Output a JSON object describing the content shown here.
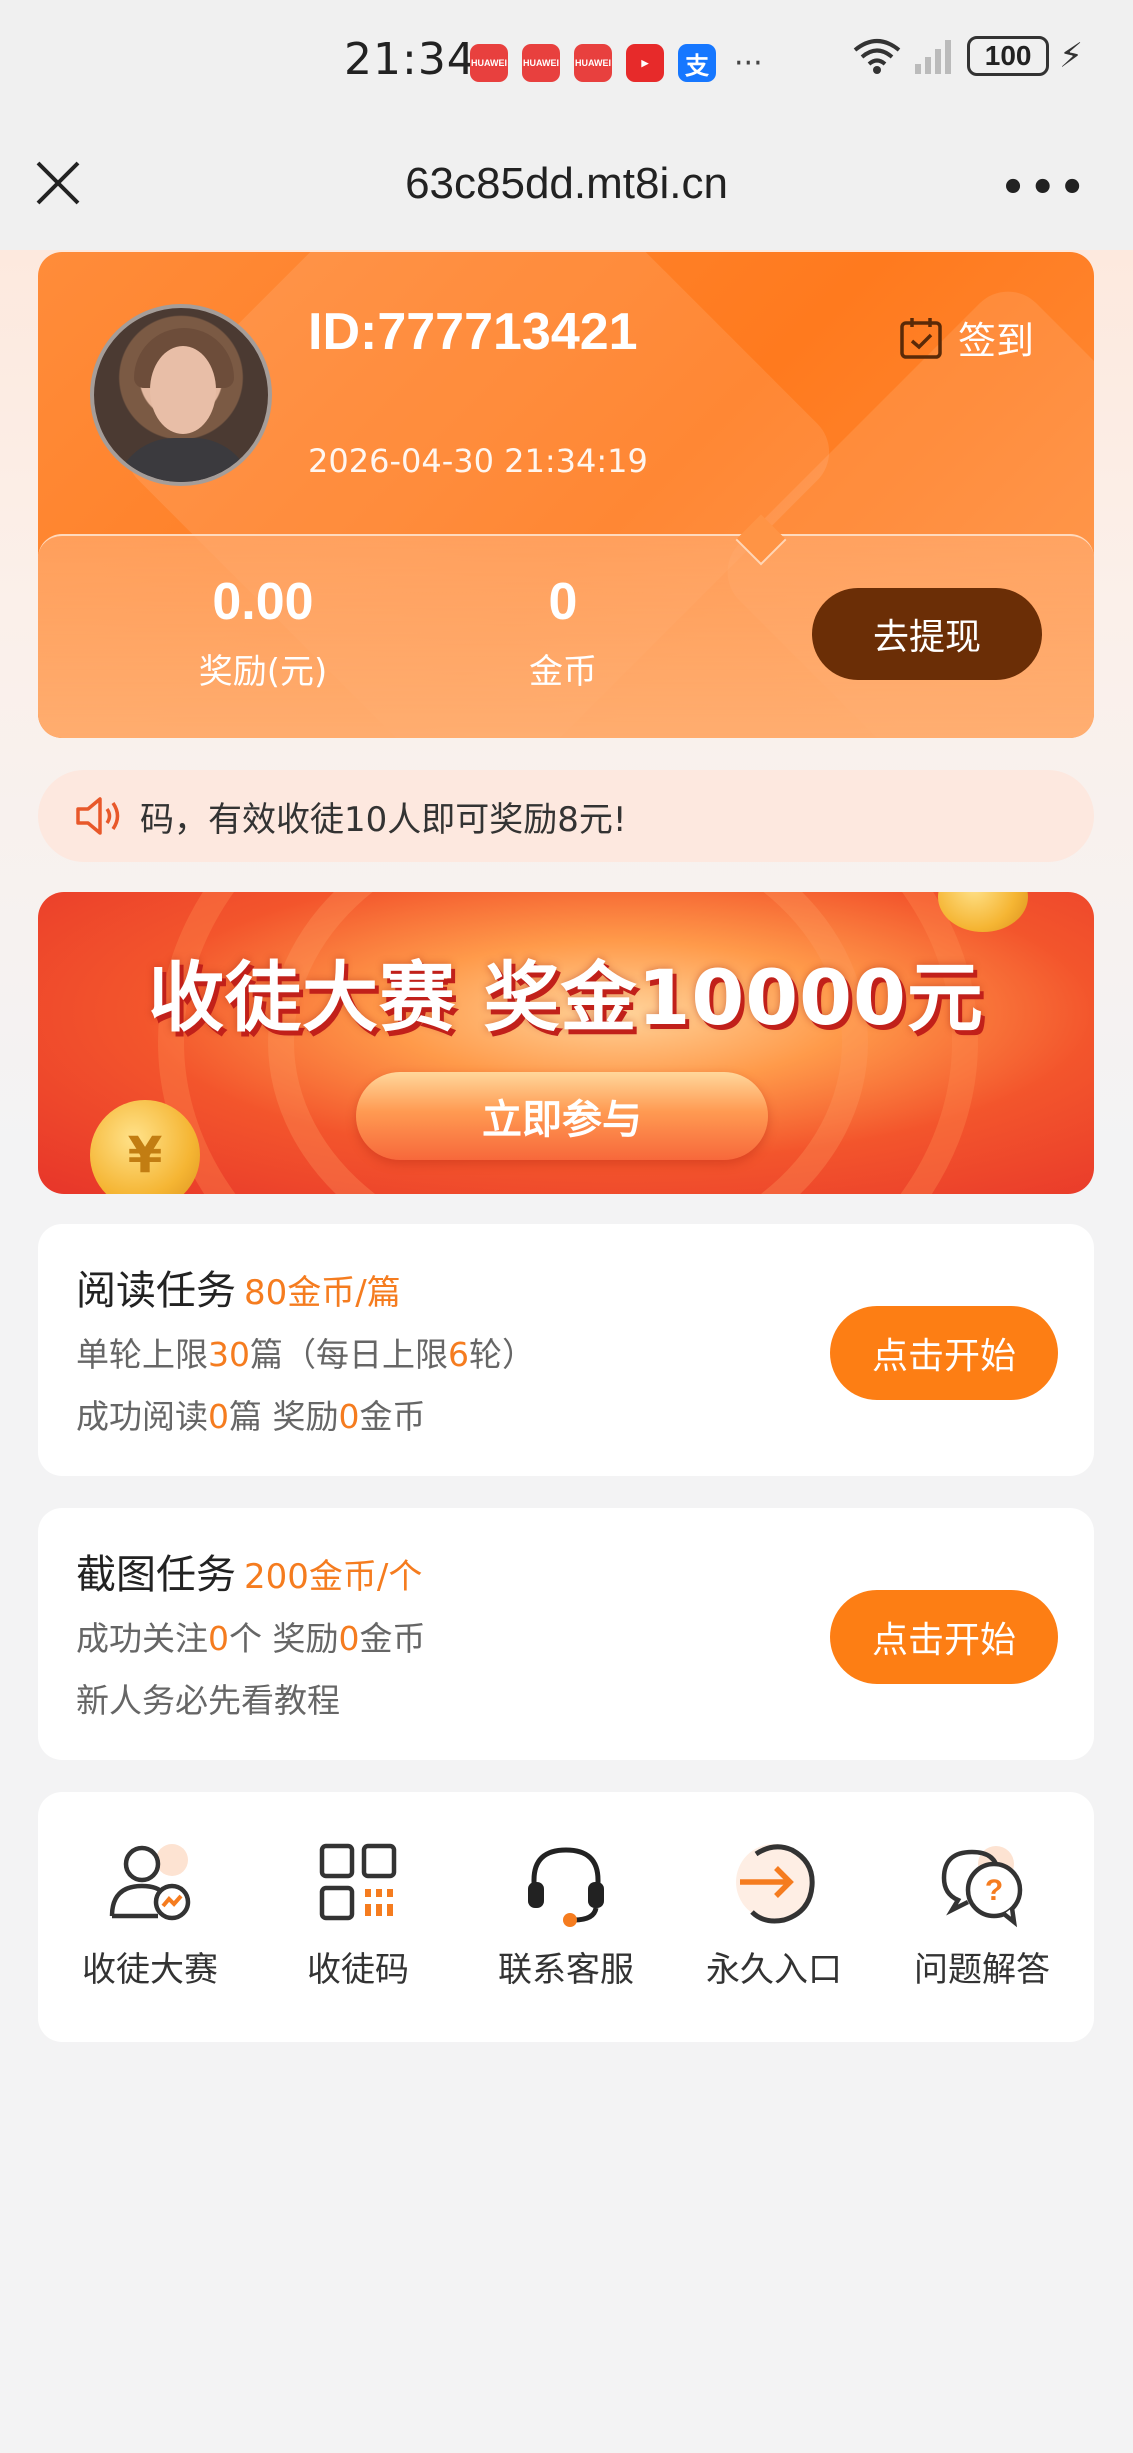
{
  "status_bar": {
    "time": "21:34",
    "apps": [
      "HUAWEI",
      "HUAWEI",
      "HUAWEI",
      "▶",
      "支"
    ],
    "more": "···",
    "battery": "100"
  },
  "nav": {
    "url": "63c85dd.mt8i.cn",
    "more": "•••"
  },
  "profile": {
    "id": "ID:777713421",
    "datetime": "2026-04-30 21:34:19",
    "checkin_label": "签到",
    "reward_value": "0.00",
    "reward_label": "奖励(元)",
    "coins_value": "0",
    "coins_label": "金币",
    "withdraw_label": "去提现"
  },
  "notice": {
    "text": "码，有效收徒10人即可奖励8元!"
  },
  "banner": {
    "title": "收徒大赛 奖金10000元",
    "button_label": "立即参与"
  },
  "tasks": [
    {
      "title": "阅读任务",
      "rate": "80金币/篇",
      "line1": [
        "单轮上限",
        "30",
        "篇（每日上限",
        "6",
        "轮）"
      ],
      "line2": [
        "成功阅读",
        "0",
        "篇 奖励",
        "0",
        "金币"
      ],
      "button_label": "点击开始"
    },
    {
      "title": "截图任务",
      "rate": "200金币/个",
      "line1": [
        "成功关注",
        "0",
        "个 奖励",
        "0",
        "金币"
      ],
      "line2": "新人务必先看教程",
      "button_label": "点击开始"
    }
  ],
  "menu": [
    {
      "label": "收徒大赛",
      "icon": "user-chart-icon"
    },
    {
      "label": "收徒码",
      "icon": "qr-code-icon"
    },
    {
      "label": "联系客服",
      "icon": "headset-icon"
    },
    {
      "label": "永久入口",
      "icon": "arrow-entry-icon"
    },
    {
      "label": "问题解答",
      "icon": "question-chat-icon"
    }
  ],
  "colors": {
    "accent": "#fd7e14",
    "highlight": "#f57c1f",
    "withdraw": "#6b2e06"
  }
}
